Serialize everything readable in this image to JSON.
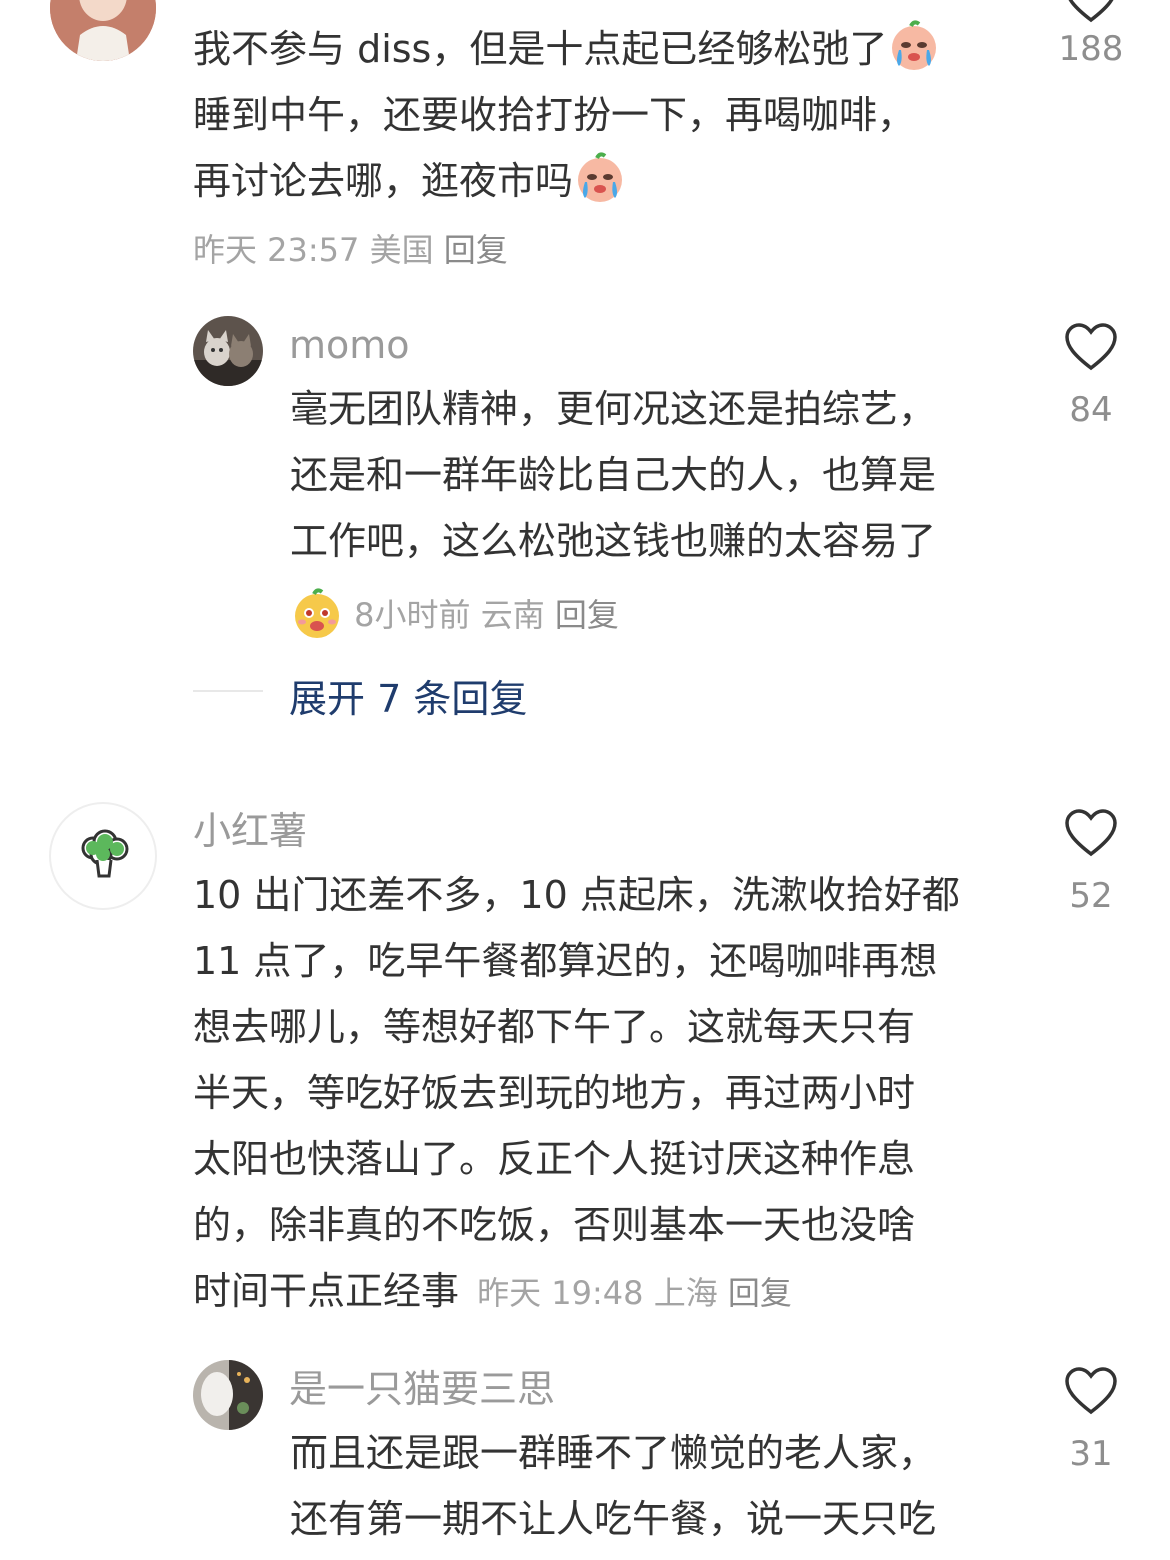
{
  "comments": [
    {
      "text_lines": [
        "我不参与 diss，但是十点起已经够松弛了",
        "睡到中午，还要收拾打扮一下，再喝咖啡，",
        "再讨论去哪，逛夜市吗"
      ],
      "meta": {
        "time": "昨天 23:57",
        "location": "美国",
        "reply": "回复"
      },
      "likes": "188",
      "reply": {
        "username": "momo",
        "text_lines": [
          "毫无团队精神，更何况这还是拍综艺，",
          "还是和一群年龄比自己大的人，也算是",
          "工作吧，这么松弛这钱也赚的太容易了"
        ],
        "meta": {
          "time": "8小时前",
          "location": "云南",
          "reply": "回复"
        },
        "likes": "84"
      },
      "expand_label": "展开 7 条回复"
    },
    {
      "username": "小红薯",
      "text_lines": [
        "10 出门还差不多，10 点起床，洗漱收拾好都",
        "11 点了，吃早午餐都算迟的，还喝咖啡再想",
        "想去哪儿，等想好都下午了。这就每天只有",
        "半天，等吃好饭去到玩的地方，再过两小时",
        "太阳也快落山了。反正个人挺讨厌这种作息",
        "的，除非真的不吃饭，否则基本一天也没啥",
        "时间干点正经事"
      ],
      "meta": {
        "time": "昨天 19:48",
        "location": "上海",
        "reply": "回复"
      },
      "likes": "52",
      "reply": {
        "username": "是一只猫要三思",
        "text_lines": [
          "而且还是跟一群睡不了懒觉的老人家，",
          "还有第一期不让人吃午餐，说一天只吃"
        ],
        "likes": "31"
      }
    }
  ],
  "colors": {
    "text": "#333333",
    "username": "#9a9a9a",
    "meta": "#a4a4a4",
    "expand": "#1f3c6d",
    "heart": "#333333"
  },
  "icons": {
    "heart": "heart-icon",
    "crying_emoji": "crying-emoji-icon",
    "cheeky_emoji": "cheeky-emoji-icon",
    "broccoli": "broccoli-icon"
  }
}
